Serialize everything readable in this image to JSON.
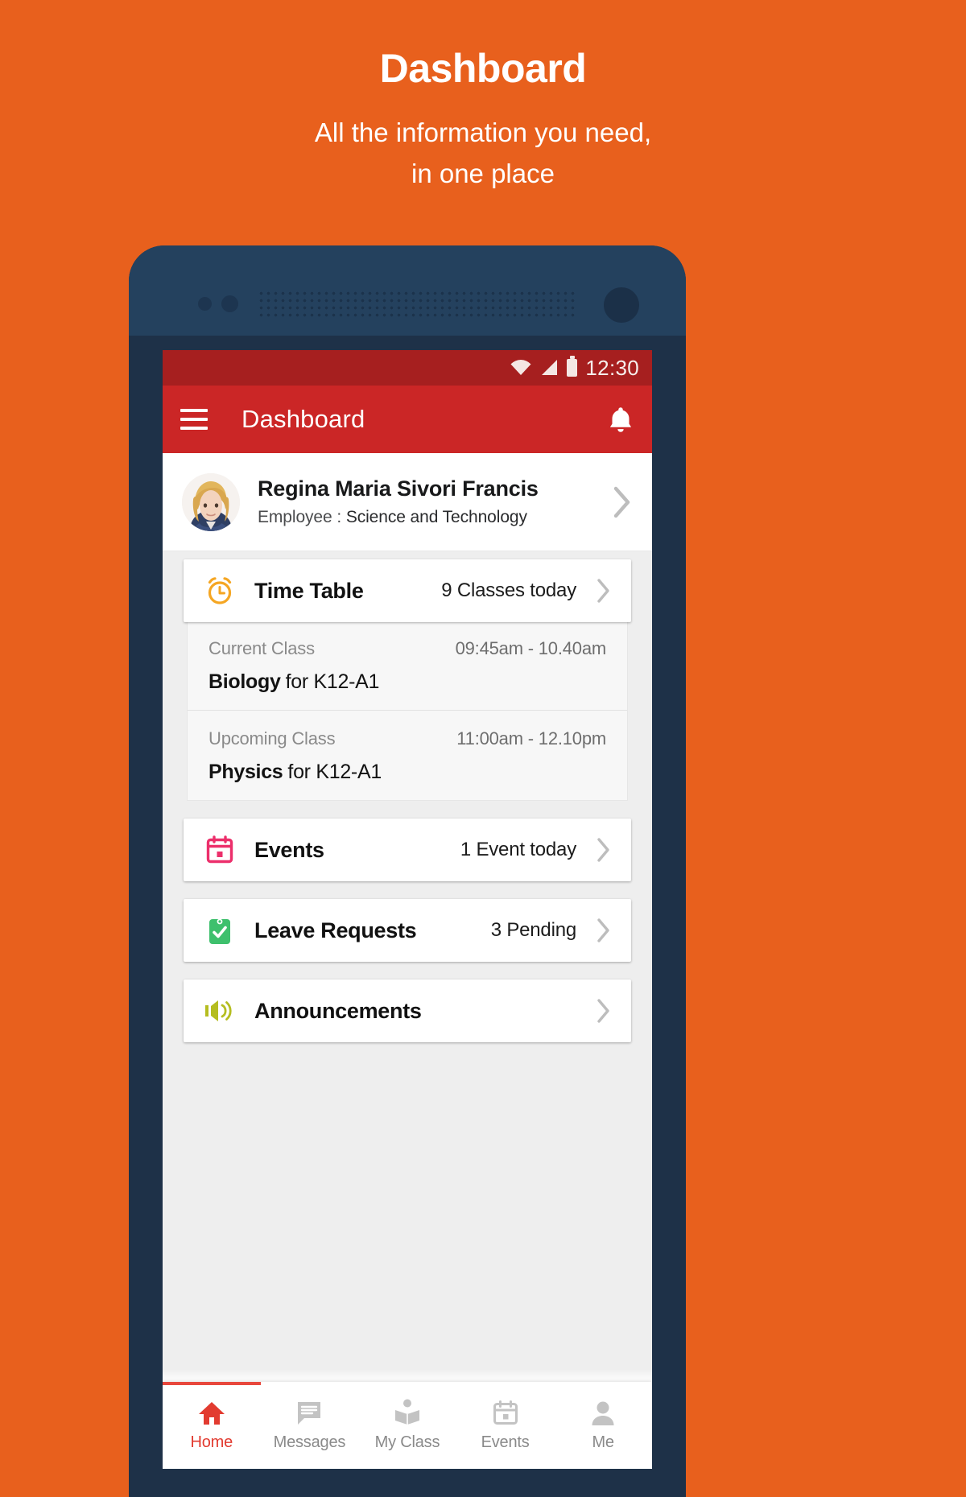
{
  "promo": {
    "title": "Dashboard",
    "subtitle_line1": "All the information you need,",
    "subtitle_line2": "in one place"
  },
  "colors": {
    "background": "#e8601d",
    "appbar": "#cb2626",
    "statusbar": "#a61f1f",
    "accent_red": "#e23b30",
    "phone_body": "#1e3148",
    "icon_timetable": "#f5a623",
    "icon_events": "#ec2f6b",
    "icon_leave": "#3ec06d",
    "icon_announcements": "#b5bd20"
  },
  "statusbar": {
    "time": "12:30",
    "icons": [
      "wifi-icon",
      "signal-icon",
      "battery-icon"
    ]
  },
  "appbar": {
    "menu_icon": "hamburger-menu-icon",
    "title": "Dashboard",
    "notification_icon": "bell-icon"
  },
  "profile": {
    "name": "Regina Maria Sivori Francis",
    "role_label": "Employee :",
    "role_value": "Science and Technology",
    "avatar": "user-avatar",
    "chevron": "chevron-right-icon"
  },
  "cards": [
    {
      "id": "time-table",
      "icon": "alarm-clock-icon",
      "title": "Time Table",
      "meta": "9 Classes today",
      "chevron": "chevron-right-icon"
    },
    {
      "id": "events",
      "icon": "calendar-icon",
      "title": "Events",
      "meta": "1 Event today",
      "chevron": "chevron-right-icon"
    },
    {
      "id": "leave-requests",
      "icon": "clipboard-check-icon",
      "title": "Leave Requests",
      "meta": "3 Pending",
      "chevron": "chevron-right-icon"
    },
    {
      "id": "announcements",
      "icon": "megaphone-icon",
      "title": "Announcements",
      "meta": "",
      "chevron": "chevron-right-icon"
    }
  ],
  "timetable_detail": {
    "current": {
      "label": "Current Class",
      "time": "09:45am - 10.40am",
      "subject": "Biology",
      "for": "for K12-A1"
    },
    "upcoming": {
      "label": "Upcoming Class",
      "time": "11:00am - 12.10pm",
      "subject": "Physics",
      "for": "for K12-A1"
    }
  },
  "bottom_nav": {
    "items": [
      {
        "label": "Home",
        "icon": "home-icon",
        "active": true
      },
      {
        "label": "Messages",
        "icon": "chat-bubble-icon",
        "active": false
      },
      {
        "label": "My Class",
        "icon": "open-book-icon",
        "active": false
      },
      {
        "label": "Events",
        "icon": "calendar-icon",
        "active": false
      },
      {
        "label": "Me",
        "icon": "person-icon",
        "active": false
      }
    ]
  }
}
